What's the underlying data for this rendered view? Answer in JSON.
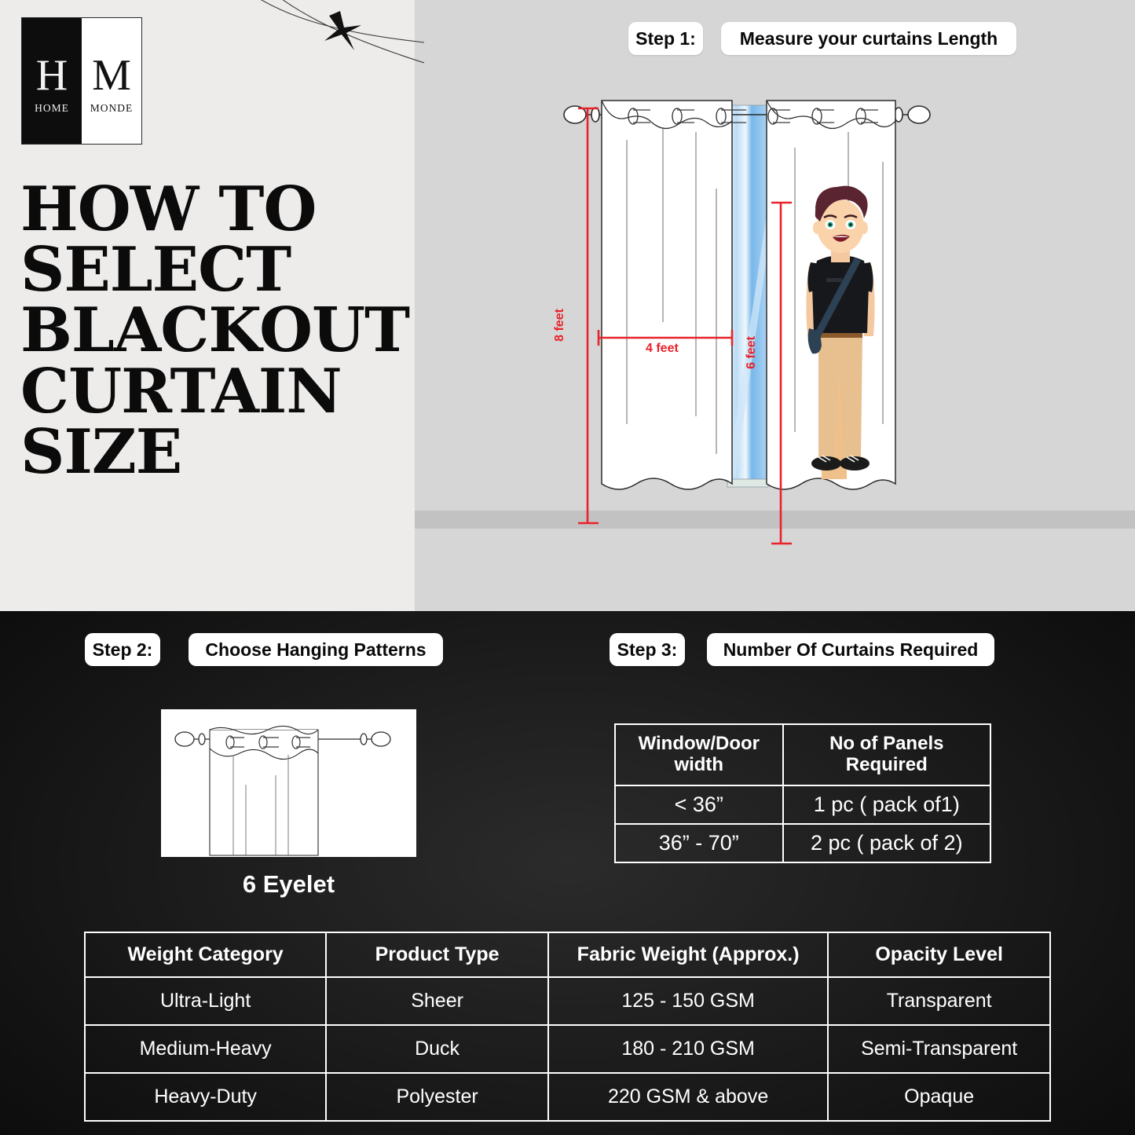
{
  "brand": {
    "logo_left_letter": "H",
    "logo_left_sub": "HOME",
    "logo_right_letter": "M",
    "logo_right_sub": "MONDE"
  },
  "headline": {
    "line1": "HOW TO",
    "line2": "SELECT",
    "line3": "BLACKOUT",
    "line4": "CURTAIN",
    "line5": "SIZE"
  },
  "steps": {
    "step1_label": "Step 1:",
    "step1_title": "Measure your curtains Length",
    "step2_label": "Step 2:",
    "step2_title": "Choose Hanging Patterns",
    "step3_label": "Step 3:",
    "step3_title": "Number Of Curtains Required"
  },
  "measurements": {
    "height_label": "8 feet",
    "width_label": "4 feet",
    "window_label": "6 feet"
  },
  "hanging_pattern": {
    "caption": "6 Eyelet"
  },
  "panels_table": {
    "headers": [
      "Window/Door width",
      "No of Panels Required"
    ],
    "header_line1": [
      "Window/Door",
      "No of Panels"
    ],
    "header_line2": [
      "width",
      "Required"
    ],
    "rows": [
      [
        "< 36”",
        "1 pc ( pack of1)"
      ],
      [
        "36” - 70”",
        "2 pc ( pack of 2)"
      ]
    ]
  },
  "fabric_table": {
    "headers": [
      "Weight Category",
      "Product Type",
      "Fabric Weight (Approx.)",
      "Opacity Level"
    ],
    "rows": [
      [
        "Ultra-Light",
        "Sheer",
        "125 - 150 GSM",
        "Transparent"
      ],
      [
        "Medium-Heavy",
        "Duck",
        "180 - 210 GSM",
        "Semi-Transparent"
      ],
      [
        "Heavy-Duty",
        "Polyester",
        "220  GSM & above",
        "Opaque"
      ]
    ]
  },
  "colors": {
    "accent_red": "#e8232a",
    "dark_bg": "#121212",
    "light_bg": "#edeceb",
    "scene_bg": "#d6d6d6"
  }
}
